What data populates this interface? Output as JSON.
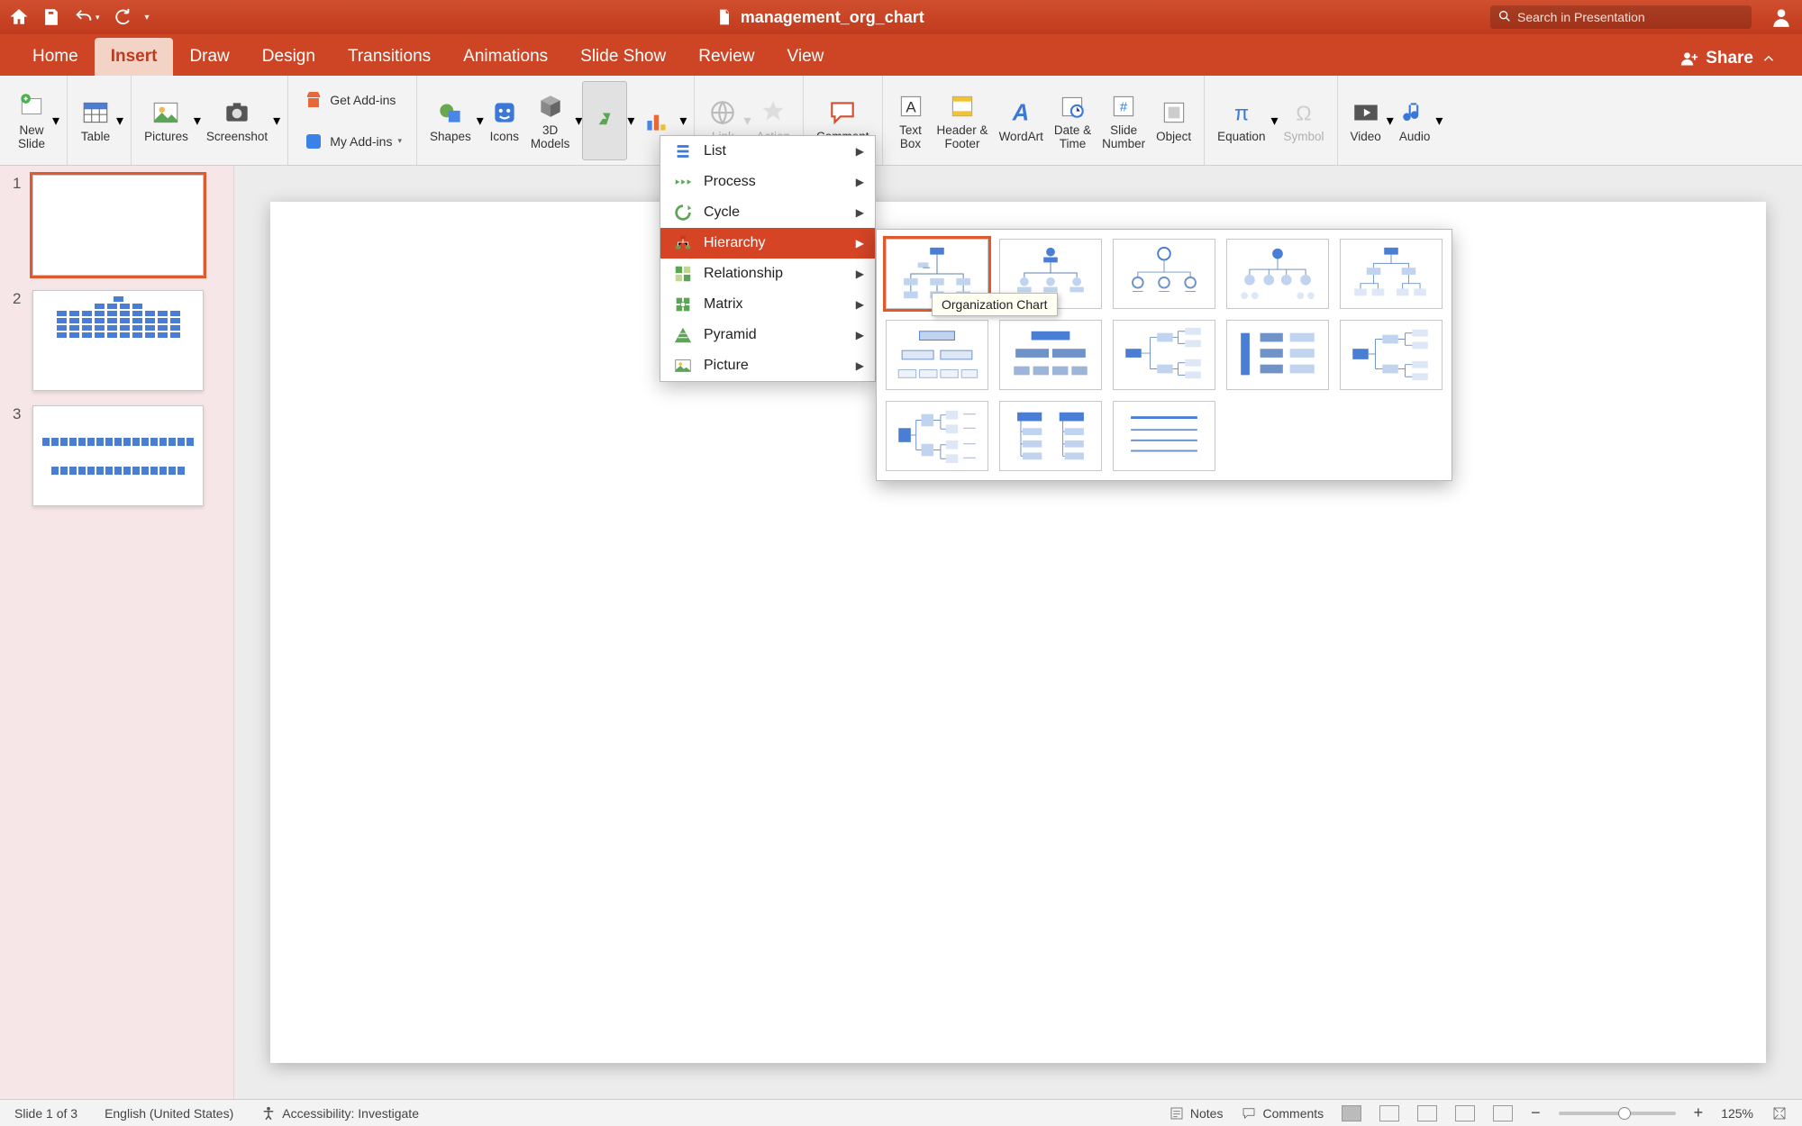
{
  "app": {
    "title": "management_org_chart",
    "search_placeholder": "Search in Presentation"
  },
  "tabs": {
    "home": "Home",
    "insert": "Insert",
    "draw": "Draw",
    "design": "Design",
    "transitions": "Transitions",
    "animations": "Animations",
    "slideshow": "Slide Show",
    "review": "Review",
    "view": "View",
    "share": "Share"
  },
  "ribbon": {
    "newslide": "New\nSlide",
    "table": "Table",
    "pictures": "Pictures",
    "screenshot": "Screenshot",
    "getaddins": "Get Add-ins",
    "myaddins": "My Add-ins",
    "shapes": "Shapes",
    "icons": "Icons",
    "models3d": "3D\nModels",
    "link": "Link",
    "action": "Action",
    "comment": "Comment",
    "textbox": "Text\nBox",
    "headerfooter": "Header &\nFooter",
    "wordart": "WordArt",
    "datetime": "Date &\nTime",
    "slidenum": "Slide\nNumber",
    "object": "Object",
    "equation": "Equation",
    "symbol": "Symbol",
    "video": "Video",
    "audio": "Audio"
  },
  "smartart_menu": {
    "list": "List",
    "process": "Process",
    "cycle": "Cycle",
    "hierarchy": "Hierarchy",
    "relationship": "Relationship",
    "matrix": "Matrix",
    "pyramid": "Pyramid",
    "picture": "Picture"
  },
  "gallery": {
    "tooltip": "Organization Chart"
  },
  "thumbs": {
    "n1": "1",
    "n2": "2",
    "n3": "3"
  },
  "status": {
    "slide": "Slide 1 of 3",
    "lang": "English (United States)",
    "access": "Accessibility: Investigate",
    "notes": "Notes",
    "comments": "Comments",
    "zoom": "125%"
  }
}
